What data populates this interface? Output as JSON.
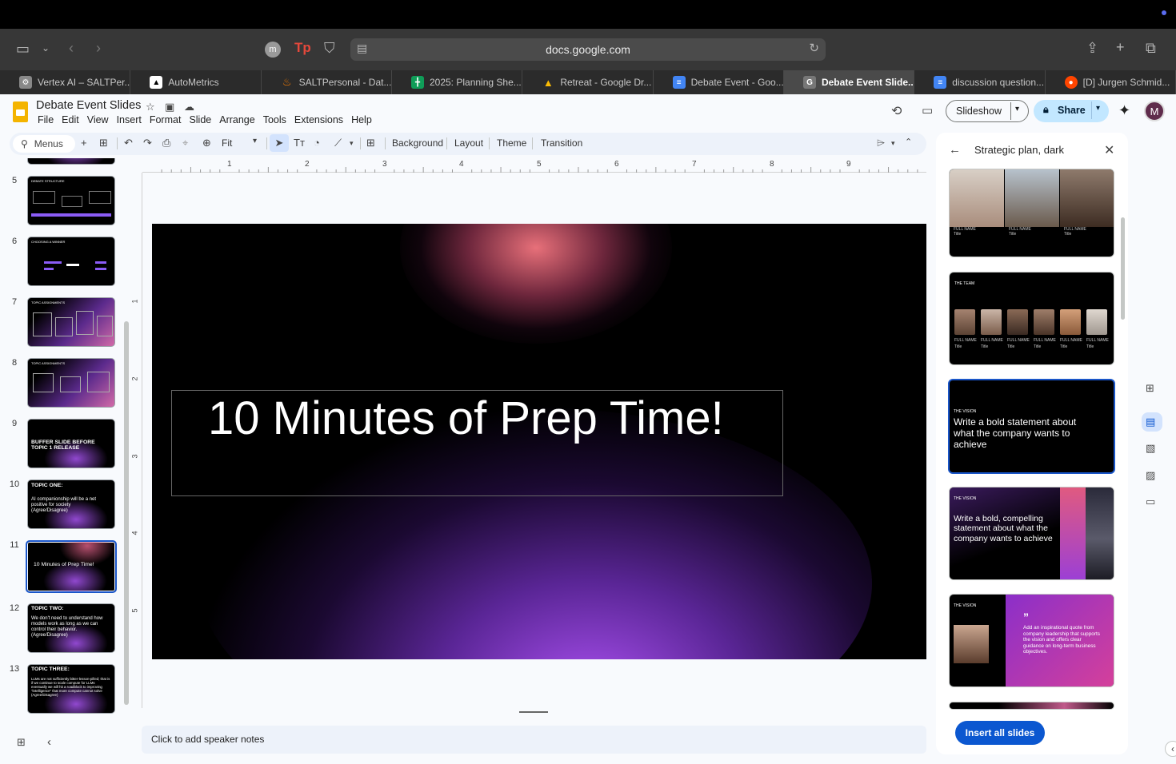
{
  "browser": {
    "url": "docs.google.com",
    "profile_initial": "m",
    "tabs": [
      {
        "label": "Vertex AI – SALTPer...",
        "icon": "gear-icon",
        "color": "#888888"
      },
      {
        "label": "AutoMetrics",
        "icon": "triangle-logo-icon",
        "color": "#ffffff"
      },
      {
        "label": "SALTPersonal - Dat...",
        "icon": "firebase-icon",
        "color": "#f57c00"
      },
      {
        "label": "2025: Planning She...",
        "icon": "sheets-icon",
        "color": "#0f9d58"
      },
      {
        "label": "Retreat - Google Dr...",
        "icon": "drive-icon",
        "color": "#fbbc04"
      },
      {
        "label": "Debate Event - Goo...",
        "icon": "docs-icon",
        "color": "#4285f4"
      },
      {
        "label": "Debate Event Slide...",
        "icon": "slides-icon",
        "color": "#777777"
      },
      {
        "label": "discussion question...",
        "icon": "docs-icon",
        "color": "#4285f4"
      },
      {
        "label": "[D] Jurgen Schmid...",
        "icon": "reddit-icon",
        "color": "#ff4500"
      }
    ]
  },
  "app": {
    "doc_title": "Debate Event Slides",
    "menu": [
      "File",
      "Edit",
      "View",
      "Insert",
      "Format",
      "Slide",
      "Arrange",
      "Tools",
      "Extensions",
      "Help"
    ],
    "slideshow_label": "Slideshow",
    "share_label": "Share",
    "avatar_initial": "M"
  },
  "toolbar": {
    "search_label": "Menus",
    "zoom_label": "Fit",
    "background_label": "Background",
    "layout_label": "Layout",
    "theme_label": "Theme",
    "transition_label": "Transition"
  },
  "ruler": {
    "h": [
      "1",
      "2",
      "3",
      "4",
      "5",
      "6",
      "7",
      "8",
      "9"
    ],
    "v": [
      "1",
      "2",
      "3",
      "4",
      "5"
    ]
  },
  "slide": {
    "title": "10 Minutes of Prep Time!"
  },
  "filmstrip": [
    {
      "num": "5",
      "title": "DEBATE STRUCTURE"
    },
    {
      "num": "6",
      "title": "CHOOSING A WINNER"
    },
    {
      "num": "7",
      "title": "TOPIC ASSIGNMENTS"
    },
    {
      "num": "8",
      "title": "TOPIC ASSIGNMENTS"
    },
    {
      "num": "9",
      "title": "BUFFER SLIDE BEFORE TOPIC 1 RELEASE"
    },
    {
      "num": "10",
      "title": "TOPIC ONE:",
      "body": "AI companionship will be a net positive for society (Agree/Disagree)"
    },
    {
      "num": "11",
      "title": "10 Minutes of Prep Time!"
    },
    {
      "num": "12",
      "title": "TOPIC TWO:",
      "body": "We don't need to understand how models work as long as we can control their behavior. (Agree/Disagree)"
    },
    {
      "num": "13",
      "title": "TOPIC THREE:",
      "body": "LLMs are not sufficiently bitter-lesson-pilled; that is if we continue to scale compute for LLMs eventually we will hit a roadblock to improving \"intelligence\" that more compute cannot solve (Agree/Disagree)"
    }
  ],
  "notes_placeholder": "Click to add speaker notes",
  "panel": {
    "title": "Strategic plan, dark",
    "insert_label": "Insert all slides",
    "templates": [
      {
        "kind": "people",
        "name_label": "FULL NAME",
        "role_label": "Title"
      },
      {
        "kind": "team",
        "heading": "THE TEAM",
        "name_label": "FULL NAME",
        "role_label": "Title"
      },
      {
        "kind": "vision",
        "heading": "THE VISION",
        "text": "Write a bold statement about what the company wants to achieve"
      },
      {
        "kind": "vision2",
        "heading": "THE VISION",
        "text": "Write a bold, compelling statement about what the company wants to achieve"
      },
      {
        "kind": "quote",
        "heading": "THE VISION",
        "quote_mark": "”",
        "text": "Add an inspirational quote from company leadership that supports the vision and offers clear guidance on long-term business objectives."
      }
    ]
  }
}
